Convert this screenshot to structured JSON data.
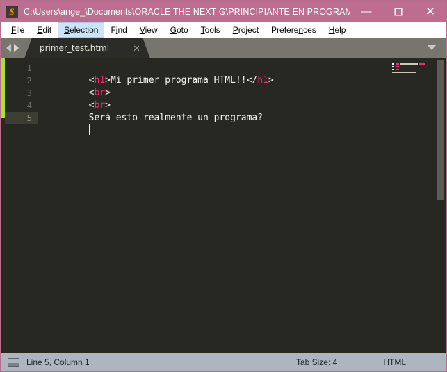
{
  "window": {
    "title": "C:\\Users\\ange_\\Documents\\ORACLE THE NEXT G\\PRINCIPIANTE EN PROGRAMACION\\...",
    "app_icon_letter": "S",
    "colors": {
      "titlebar": "#bd6e90",
      "editor_bg": "#272822",
      "accent_green": "#a6e22e",
      "tag_pink": "#f92672",
      "statusbar": "#aeb5c0"
    },
    "controls": {
      "minimize": "—",
      "maximize": "□",
      "close": "✕"
    }
  },
  "menubar": {
    "items": [
      {
        "label": "File",
        "accel": "F",
        "active": false
      },
      {
        "label": "Edit",
        "accel": "E",
        "active": false
      },
      {
        "label": "Selection",
        "accel": "S",
        "active": true
      },
      {
        "label": "Find",
        "accel": "i",
        "active": false
      },
      {
        "label": "View",
        "accel": "V",
        "active": false
      },
      {
        "label": "Goto",
        "accel": "G",
        "active": false
      },
      {
        "label": "Tools",
        "accel": "T",
        "active": false
      },
      {
        "label": "Project",
        "accel": "P",
        "active": false
      },
      {
        "label": "Preferences",
        "accel": "n",
        "active": false
      },
      {
        "label": "Help",
        "accel": "H",
        "active": false
      }
    ]
  },
  "tabbar": {
    "nav_prev_icon": "arrow-left-icon",
    "nav_next_icon": "arrow-right-icon",
    "tabs": [
      {
        "label": "primer_test.html",
        "close_glyph": "✕",
        "active": true
      }
    ],
    "overflow_icon": "chevron-down-icon"
  },
  "editor": {
    "language": "HTML",
    "current_line": 5,
    "lines": [
      {
        "number": "1",
        "tokens": [
          {
            "t": "punct",
            "v": "<"
          },
          {
            "t": "tag",
            "v": "h1"
          },
          {
            "t": "punct",
            "v": ">"
          },
          {
            "t": "text",
            "v": "Mi primer programa HTML!!"
          },
          {
            "t": "punct",
            "v": "</"
          },
          {
            "t": "tag",
            "v": "h1"
          },
          {
            "t": "punct",
            "v": ">"
          }
        ]
      },
      {
        "number": "2",
        "tokens": [
          {
            "t": "punct",
            "v": "<"
          },
          {
            "t": "tag",
            "v": "br"
          },
          {
            "t": "punct",
            "v": ">"
          }
        ]
      },
      {
        "number": "3",
        "tokens": [
          {
            "t": "punct",
            "v": "<"
          },
          {
            "t": "tag",
            "v": "br"
          },
          {
            "t": "punct",
            "v": ">"
          }
        ]
      },
      {
        "number": "4",
        "tokens": [
          {
            "t": "text",
            "v": "Será esto realmente un programa?"
          }
        ]
      },
      {
        "number": "5",
        "tokens": []
      }
    ],
    "plain_text": "<h1>Mi primer programa HTML!!</h1>\n<br>\n<br>\nSerá esto realmente un programa?\n"
  },
  "statusbar": {
    "sidebar_toggle_icon": "panel-toggle-icon",
    "cursor_position": "Line 5, Column 1",
    "tab_size": "Tab Size: 4",
    "syntax": "HTML"
  }
}
